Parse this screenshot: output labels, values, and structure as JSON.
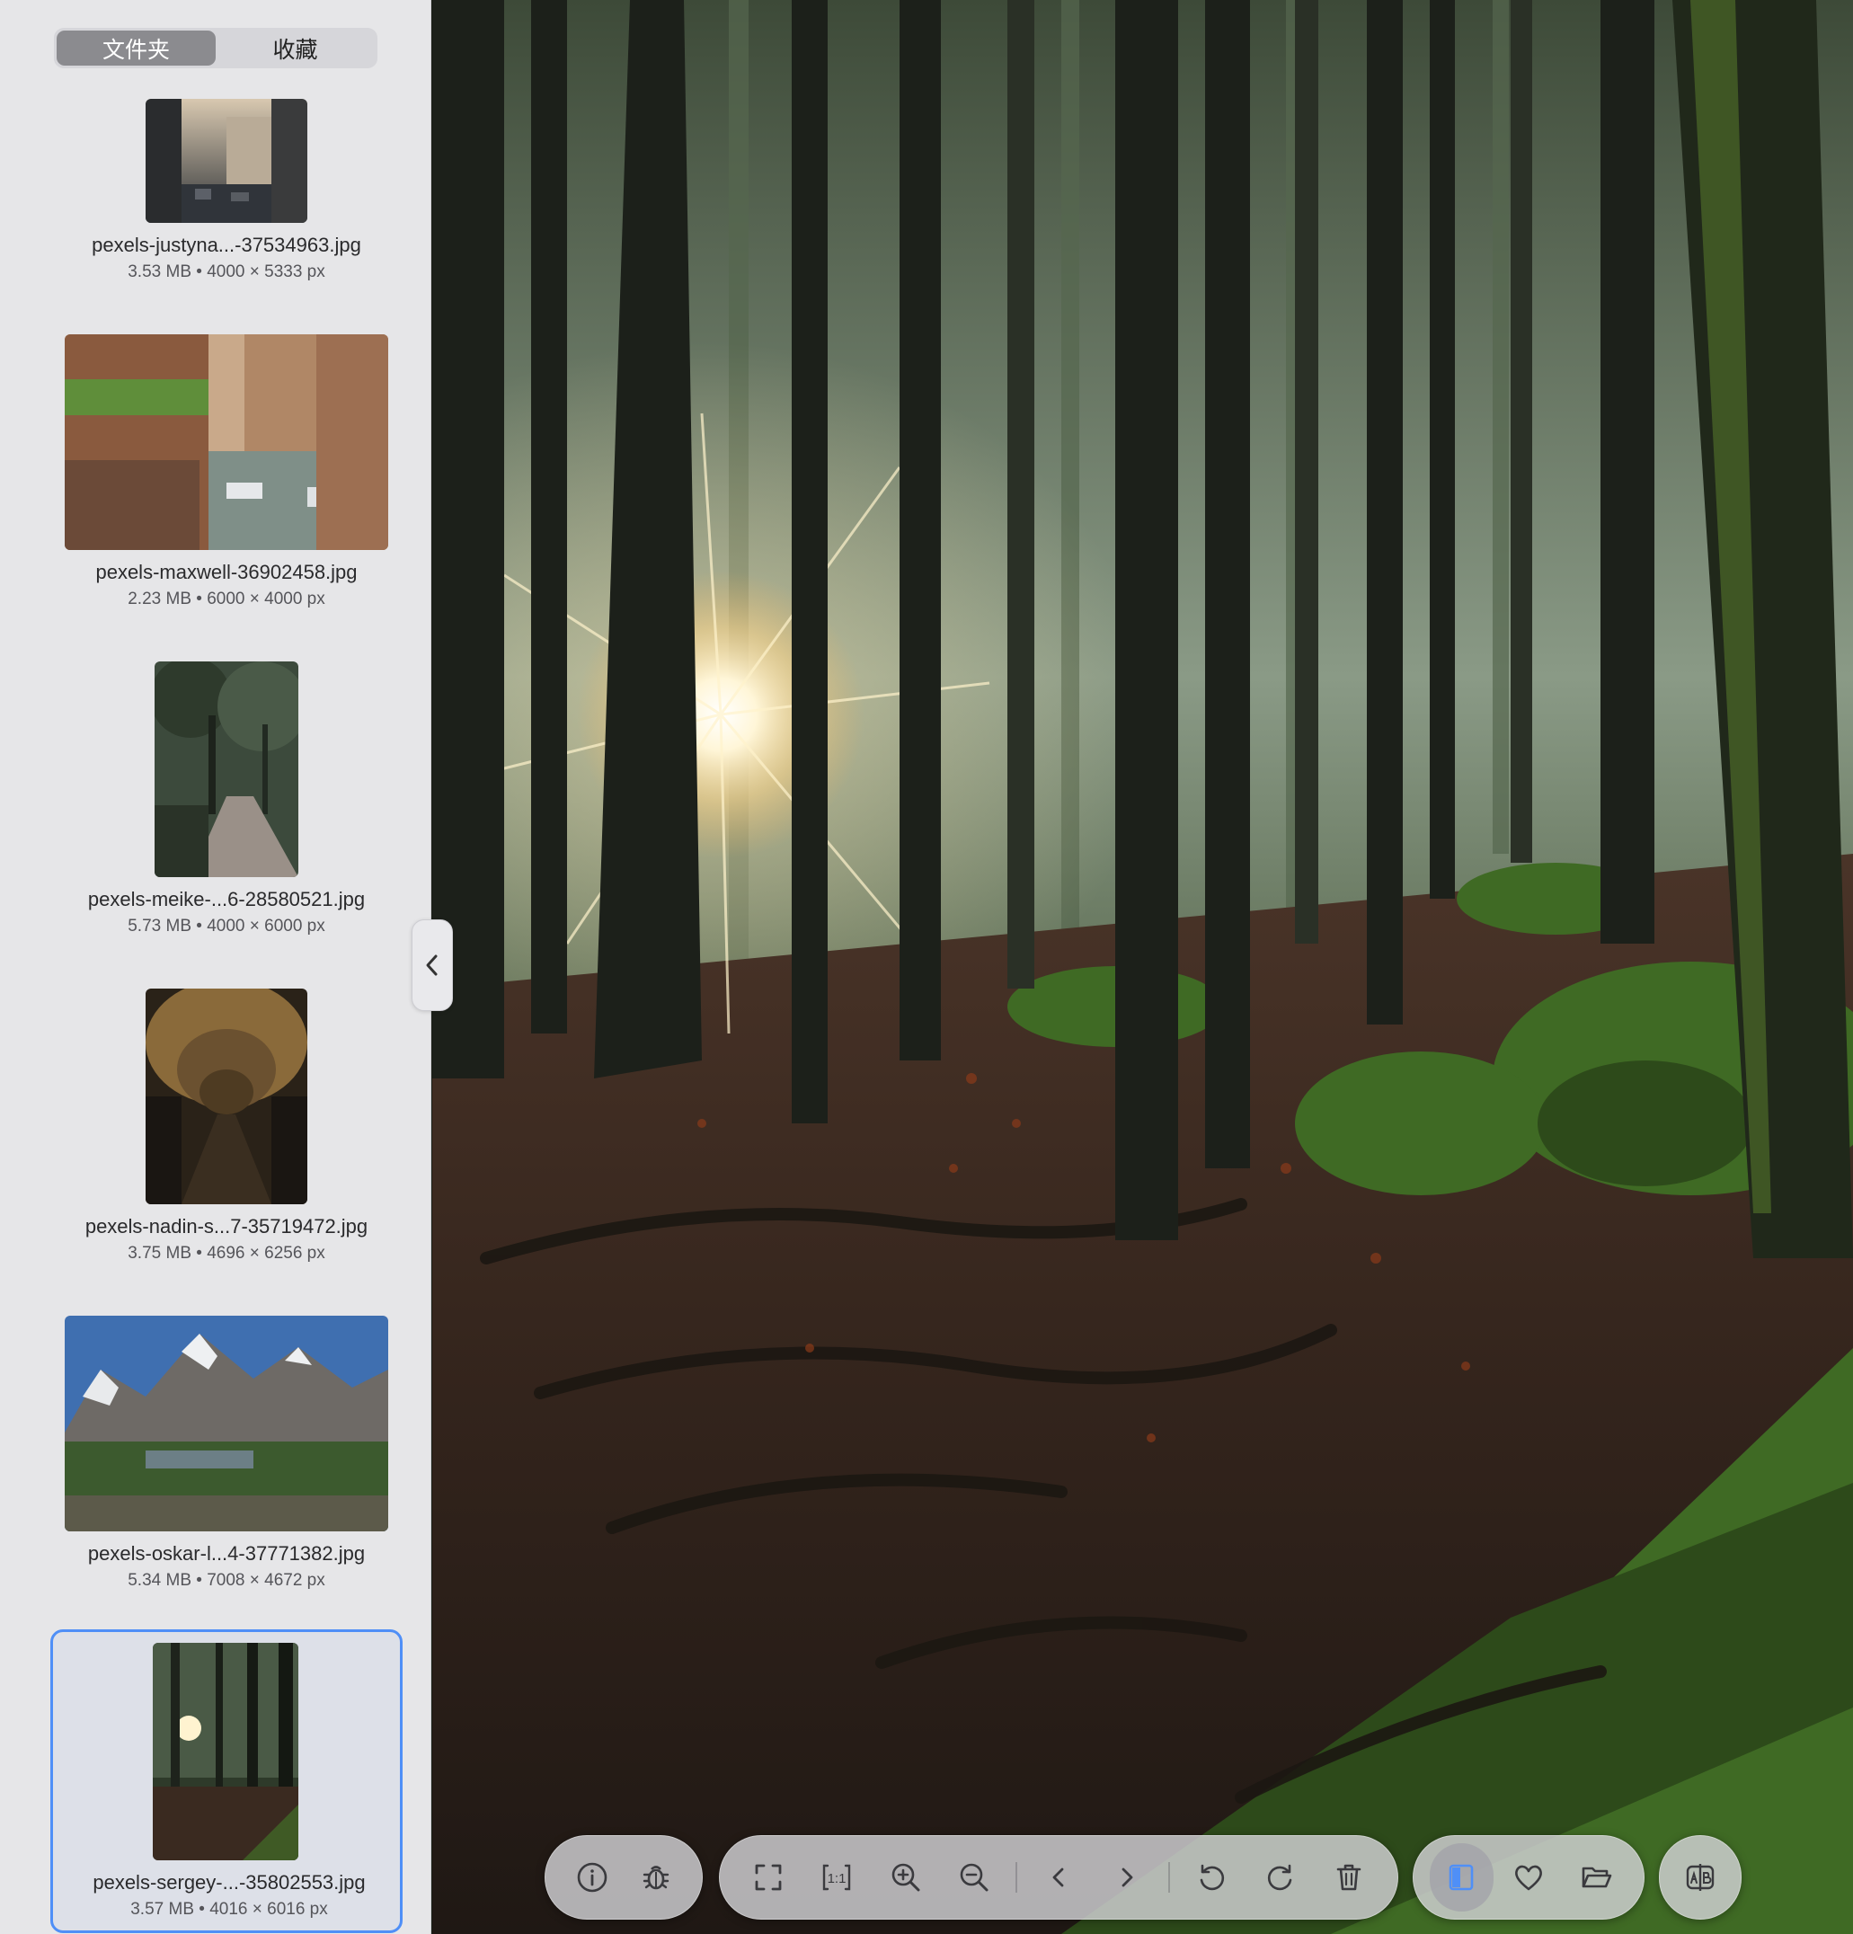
{
  "sidebar": {
    "tabs": [
      {
        "label": "文件夹",
        "active": true
      },
      {
        "label": "收藏",
        "active": false
      }
    ],
    "items": [
      {
        "name": "pexels-justyna...-37534963.jpg",
        "meta": "3.53 MB • 4000 × 5333 px",
        "selected": false
      },
      {
        "name": "pexels-maxwell-36902458.jpg",
        "meta": "2.23 MB • 6000 × 4000 px",
        "selected": false
      },
      {
        "name": "pexels-meike-...6-28580521.jpg",
        "meta": "5.73 MB • 4000 × 6000 px",
        "selected": false
      },
      {
        "name": "pexels-nadin-s...7-35719472.jpg",
        "meta": "3.75 MB • 4696 × 6256 px",
        "selected": false
      },
      {
        "name": "pexels-oskar-l...4-37771382.jpg",
        "meta": "5.34 MB • 7008 × 4672 px",
        "selected": false
      },
      {
        "name": "pexels-sergey-...-35802553.jpg",
        "meta": "3.57 MB • 4016 × 6016 px",
        "selected": true
      }
    ]
  },
  "toolbar": {
    "group1": [
      "info-icon",
      "debug-icon"
    ],
    "group2": [
      "fullscreen-icon",
      "actual-size-icon",
      "zoom-in-icon",
      "zoom-out-icon",
      "previous-icon",
      "next-icon",
      "rotate-left-icon",
      "rotate-right-icon",
      "trash-icon"
    ],
    "group3": [
      "sidebar-toggle-icon",
      "favorite-icon",
      "open-folder-icon"
    ],
    "group4": [
      "compare-icon"
    ],
    "actual_size_label": "1:1",
    "accent": "#4f8ff7"
  }
}
